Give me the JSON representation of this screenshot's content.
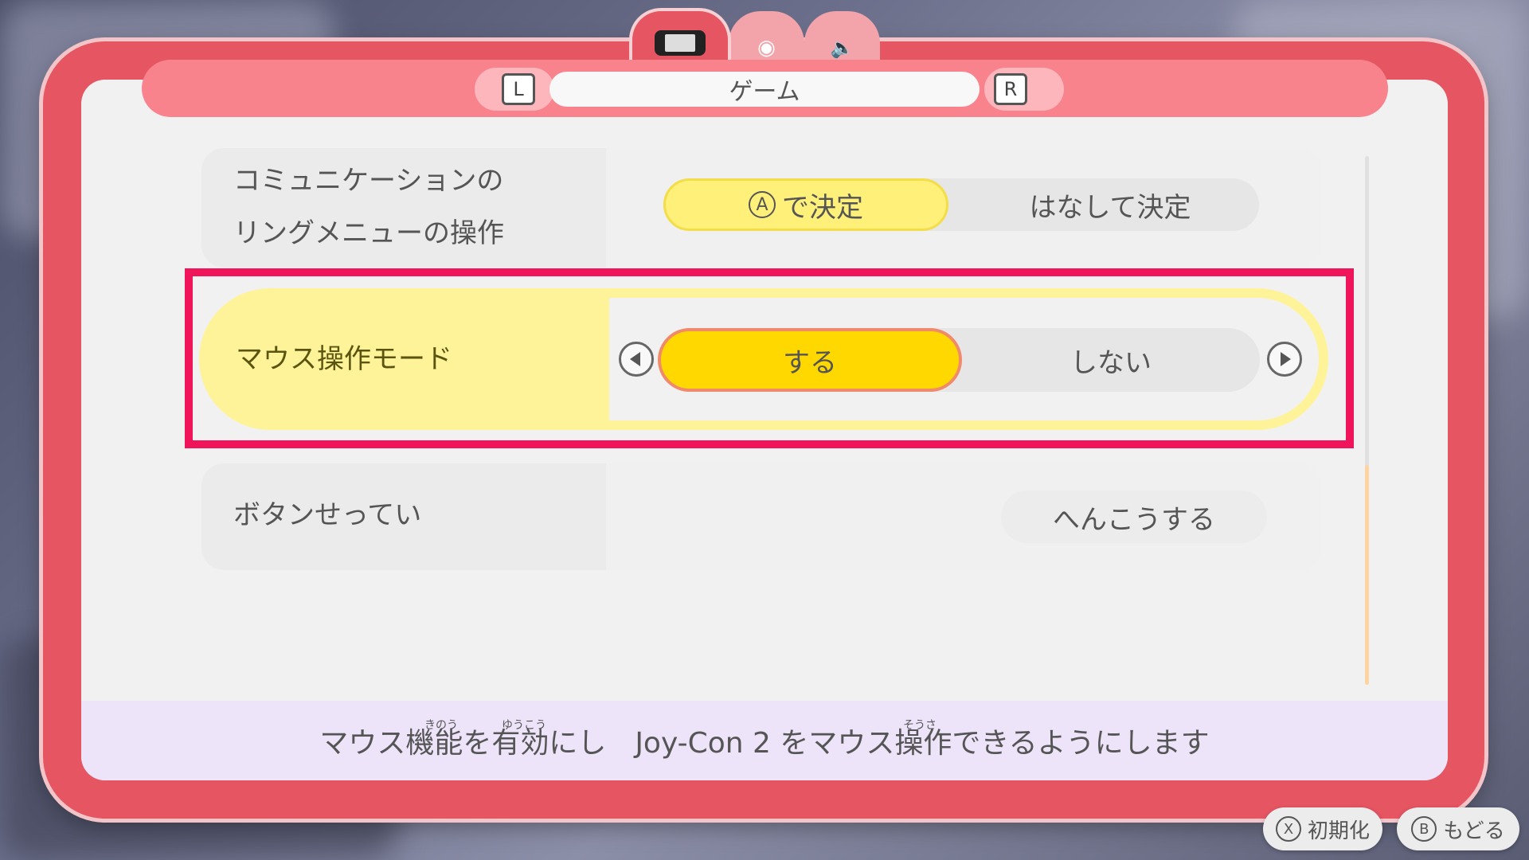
{
  "header": {
    "tab_title": "ゲーム",
    "left_bumper": "L",
    "right_bumper": "R"
  },
  "top_tabs": [
    {
      "name": "game",
      "icon": "switch-console-icon",
      "active": true
    },
    {
      "name": "camera",
      "icon": "camera-icon",
      "active": false
    },
    {
      "name": "sound",
      "icon": "speaker-icon",
      "active": false
    }
  ],
  "settings": {
    "ring_menu": {
      "label_line1": "コミュニケーションの",
      "label_line2": "リングメニューの操作",
      "option_a_key": "A",
      "option_a": "で決定",
      "option_b": "はなして決定",
      "selected": "option_a"
    },
    "mouse_mode": {
      "label": "マウス操作モード",
      "option_on": "する",
      "option_off": "しない",
      "selected": "option_on"
    },
    "button_config": {
      "label": "ボタンせってい",
      "action": "へんこうする"
    }
  },
  "footer": {
    "description": "マウス機能を有効にし　Joy-Con 2 をマウス操作できるようにします",
    "furigana": [
      "きのう",
      "ゆうこう",
      "そうさ"
    ]
  },
  "bottom_buttons": {
    "reset_key": "X",
    "reset_label": "初期化",
    "back_key": "B",
    "back_label": "もどる"
  },
  "colors": {
    "frame": "#e65562",
    "highlight_box": "#f0145a",
    "selected_option": "#ffd800",
    "row_highlight": "#fff39a",
    "footer_bg": "#ede4fa"
  }
}
